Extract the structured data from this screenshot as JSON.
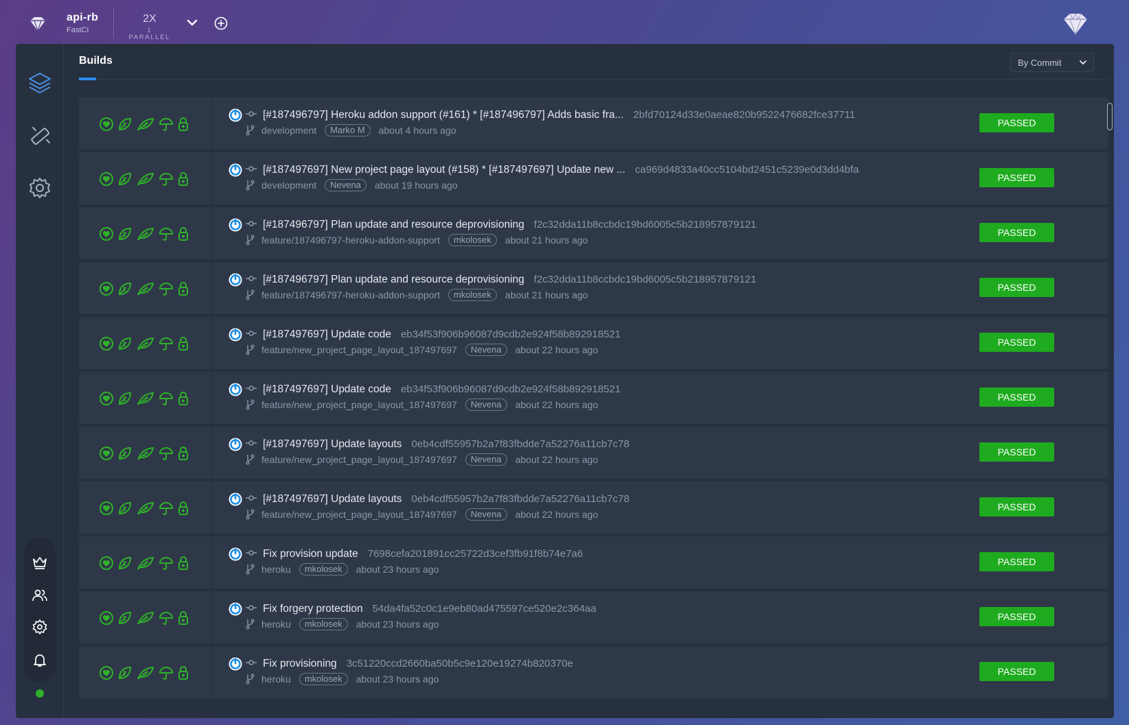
{
  "header": {
    "project_name": "api-rb",
    "org_name": "FastCI",
    "parallel_value": "2X",
    "parallel_label": "1 PARALLEL"
  },
  "tabs": {
    "builds": "Builds"
  },
  "filter": {
    "selected": "By Commit"
  },
  "colors": {
    "accent": "#2d8cf0",
    "passed": "#1fab1f",
    "icon_green": "#2fb12a"
  },
  "builds": [
    {
      "message": "[#187496797] Heroku addon support (#161) * [#187496797] Adds basic fra...",
      "sha": "2bfd70124d33e0aeae820b9522476682fce37711",
      "branch": "development",
      "author": "Marko M",
      "time": "about 4 hours ago",
      "status": "PASSED"
    },
    {
      "message": "[#187497697] New project page layout (#158) * [#187497697] Update new ...",
      "sha": "ca969d4833a40cc5104bd2451c5239e0d3dd4bfa",
      "branch": "development",
      "author": "Nevena",
      "time": "about 19 hours ago",
      "status": "PASSED"
    },
    {
      "message": "[#187496797] Plan update and resource deprovisioning",
      "sha": "f2c32dda11b8ccbdc19bd6005c5b218957879121",
      "branch": "feature/187496797-heroku-addon-support",
      "author": "mkolosek",
      "time": "about 21 hours ago",
      "status": "PASSED"
    },
    {
      "message": "[#187496797] Plan update and resource deprovisioning",
      "sha": "f2c32dda11b8ccbdc19bd6005c5b218957879121",
      "branch": "feature/187496797-heroku-addon-support",
      "author": "mkolosek",
      "time": "about 21 hours ago",
      "status": "PASSED"
    },
    {
      "message": "[#187497697] Update code",
      "sha": "eb34f53f906b96087d9cdb2e924f58b892918521",
      "branch": "feature/new_project_page_layout_187497697",
      "author": "Nevena",
      "time": "about 22 hours ago",
      "status": "PASSED"
    },
    {
      "message": "[#187497697] Update code",
      "sha": "eb34f53f906b96087d9cdb2e924f58b892918521",
      "branch": "feature/new_project_page_layout_187497697",
      "author": "Nevena",
      "time": "about 22 hours ago",
      "status": "PASSED"
    },
    {
      "message": "[#187497697] Update layouts",
      "sha": "0eb4cdf55957b2a7f83fbdde7a52276a11cb7c78",
      "branch": "feature/new_project_page_layout_187497697",
      "author": "Nevena",
      "time": "about 22 hours ago",
      "status": "PASSED"
    },
    {
      "message": "[#187497697] Update layouts",
      "sha": "0eb4cdf55957b2a7f83fbdde7a52276a11cb7c78",
      "branch": "feature/new_project_page_layout_187497697",
      "author": "Nevena",
      "time": "about 22 hours ago",
      "status": "PASSED"
    },
    {
      "message": "Fix provision update",
      "sha": "7698cefa201891cc25722d3cef3fb91f8b74e7a6",
      "branch": "heroku",
      "author": "mkolosek",
      "time": "about 23 hours ago",
      "status": "PASSED"
    },
    {
      "message": "Fix forgery protection",
      "sha": "54da4fa52c0c1e9eb80ad475597ce520e2c364aa",
      "branch": "heroku",
      "author": "mkolosek",
      "time": "about 23 hours ago",
      "status": "PASSED"
    },
    {
      "message": "Fix provisioning",
      "sha": "3c51220ccd2660ba50b5c9e120e19274b820370e",
      "branch": "heroku",
      "author": "mkolosek",
      "time": "about 23 hours ago",
      "status": "PASSED"
    }
  ]
}
